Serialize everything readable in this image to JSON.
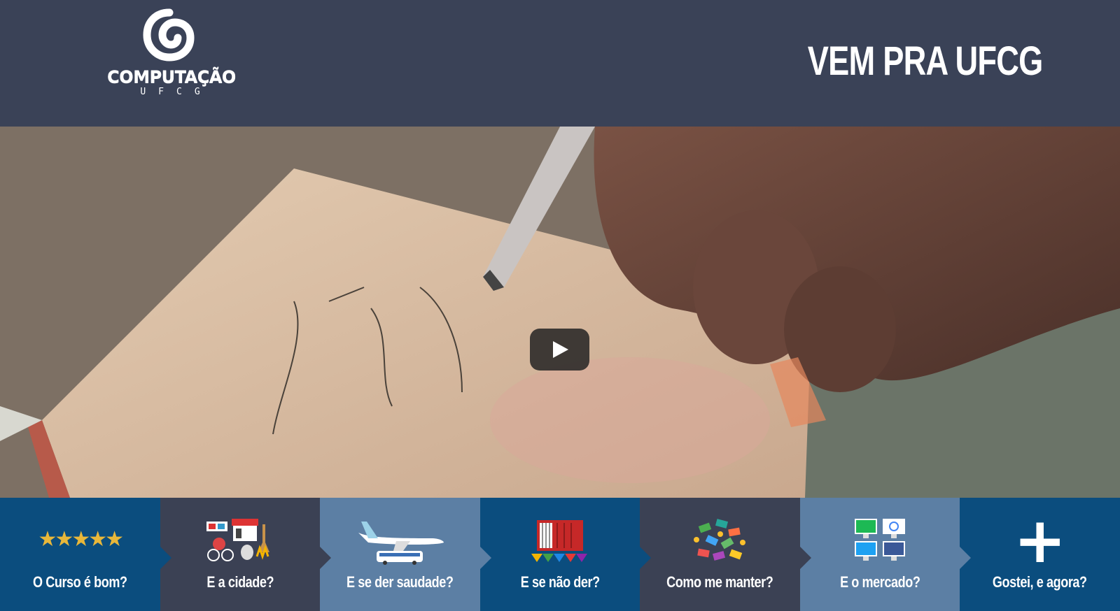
{
  "header": {
    "logo_text": "COMPUTAÇÃO",
    "logo_sub": "UFCG",
    "title": "VEM PRA UFCG"
  },
  "video": {
    "play_label": "Play"
  },
  "nav": {
    "items": [
      {
        "label": "O Curso é bom?",
        "icon": "five-stars-icon"
      },
      {
        "label": "E a cidade?",
        "icon": "city-icon"
      },
      {
        "label": "E se der saudade?",
        "icon": "airplane-bus-icon"
      },
      {
        "label": "E se não der?",
        "icon": "accordion-icon"
      },
      {
        "label": "Como me manter?",
        "icon": "money-icon"
      },
      {
        "label": "E o mercado?",
        "icon": "tech-companies-icon"
      },
      {
        "label": "Gostei, e agora?",
        "icon": "plus-icon"
      }
    ],
    "stars": "★★★★★",
    "plus": "+"
  },
  "colors": {
    "header_bg": "#3a4257",
    "nav_blue": "#0b4d7e",
    "nav_slate": "#3b4154",
    "nav_light": "#5c7fa4",
    "star": "#e8b73a"
  }
}
